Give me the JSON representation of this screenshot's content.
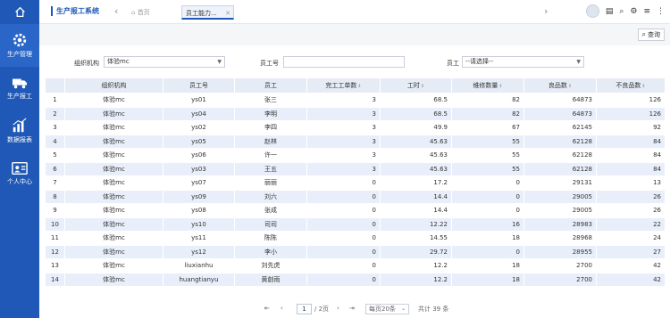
{
  "sidebar": {
    "items": [
      {
        "label": "生产管理",
        "icon": "gear-icon"
      },
      {
        "label": "生产报工",
        "icon": "truck-icon"
      },
      {
        "label": "数据报表",
        "icon": "bar-chart-icon"
      },
      {
        "label": "个人中心",
        "icon": "id-card-icon"
      }
    ]
  },
  "header": {
    "app_title": "生产报工系统",
    "tabs": [
      {
        "label": "首页"
      },
      {
        "label": "员工能力..."
      }
    ]
  },
  "toolbar": {
    "query_label": "查询"
  },
  "filters": {
    "org_label": "组织机构",
    "org_value": "体验mc",
    "empno_label": "员工号",
    "empno_value": "",
    "emp_label": "员工",
    "emp_value": "--请选择--"
  },
  "table": {
    "columns": [
      "",
      "组织机构",
      "员工号",
      "员工",
      "完工工单数",
      "工时",
      "维修数量",
      "良品数",
      "不良品数"
    ],
    "rows": [
      [
        "1",
        "体验mc",
        "ys01",
        "张三",
        "3",
        "68.5",
        "82",
        "64873",
        "126"
      ],
      [
        "2",
        "体验mc",
        "ys04",
        "李明",
        "3",
        "68.5",
        "82",
        "64873",
        "126"
      ],
      [
        "3",
        "体验mc",
        "ys02",
        "李四",
        "3",
        "49.9",
        "67",
        "62145",
        "92"
      ],
      [
        "4",
        "体验mc",
        "ys05",
        "赵林",
        "3",
        "45.63",
        "55",
        "62128",
        "84"
      ],
      [
        "5",
        "体验mc",
        "ys06",
        "许一",
        "3",
        "45.63",
        "55",
        "62128",
        "84"
      ],
      [
        "6",
        "体验mc",
        "ys03",
        "王五",
        "3",
        "45.63",
        "55",
        "62128",
        "84"
      ],
      [
        "7",
        "体验mc",
        "ys07",
        "丽丽",
        "0",
        "17.2",
        "0",
        "29131",
        "13"
      ],
      [
        "8",
        "体验mc",
        "ys09",
        "刘六",
        "0",
        "14.4",
        "0",
        "29005",
        "26"
      ],
      [
        "9",
        "体验mc",
        "ys08",
        "张成",
        "0",
        "14.4",
        "0",
        "29005",
        "26"
      ],
      [
        "10",
        "体验mc",
        "ys10",
        "司司",
        "0",
        "12.22",
        "16",
        "28983",
        "22"
      ],
      [
        "11",
        "体验mc",
        "ys11",
        "陈陈",
        "0",
        "14.55",
        "18",
        "28968",
        "24"
      ],
      [
        "12",
        "体验mc",
        "ys12",
        "李小",
        "0",
        "29.72",
        "0",
        "28955",
        "27"
      ],
      [
        "13",
        "体验mc",
        "liuxianhu",
        "刘先虎",
        "0",
        "12.2",
        "18",
        "2700",
        "42"
      ],
      [
        "14",
        "体验mc",
        "huangtianyu",
        "黄創雨",
        "0",
        "12.2",
        "18",
        "2700",
        "42"
      ]
    ]
  },
  "pager": {
    "current_page": "1",
    "total_pages": "/ 2页",
    "page_size": "每页20条",
    "total": "共计 39 条"
  }
}
